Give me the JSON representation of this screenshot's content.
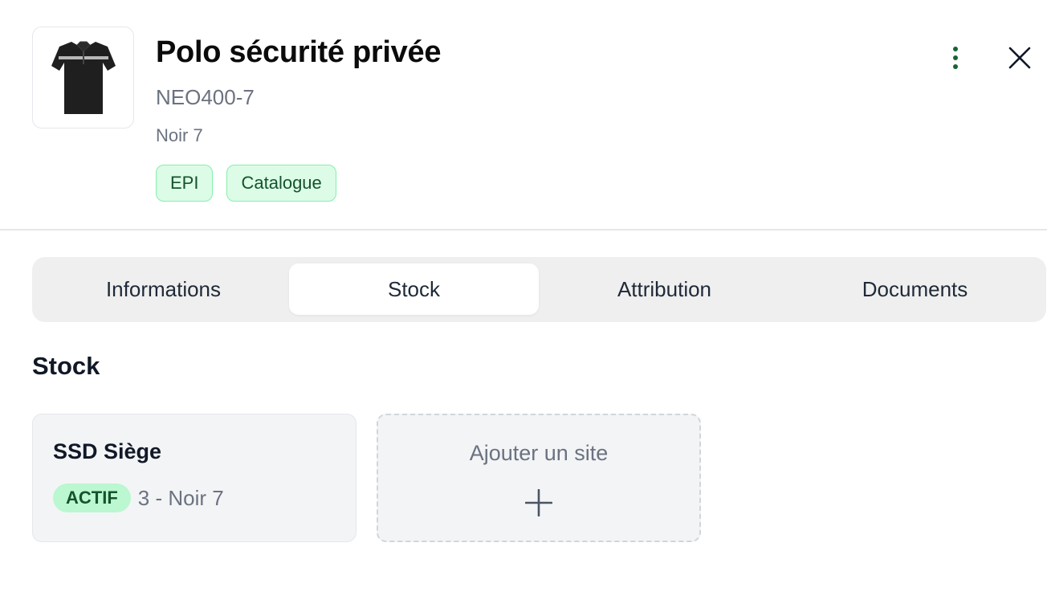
{
  "product": {
    "title": "Polo sécurité privée",
    "reference": "NEO400-7",
    "variant": "Noir 7",
    "tags": [
      "EPI",
      "Catalogue"
    ]
  },
  "header": {
    "more_icon": "vertical-dots-icon",
    "close_icon": "close-icon"
  },
  "tabs": [
    {
      "label": "Informations",
      "active": false
    },
    {
      "label": "Stock",
      "active": true
    },
    {
      "label": "Attribution",
      "active": false
    },
    {
      "label": "Documents",
      "active": false
    }
  ],
  "stock": {
    "section_title": "Stock",
    "sites": [
      {
        "name": "SSD Siège",
        "status": "ACTIF",
        "detail": "3 - Noir 7"
      }
    ],
    "add_site_label": "Ajouter un site"
  },
  "colors": {
    "tag_bg": "#dcfce7",
    "tag_border": "#86efac",
    "tag_text": "#14532d",
    "status_bg": "#bbf7d0",
    "more_icon": "#166534"
  }
}
